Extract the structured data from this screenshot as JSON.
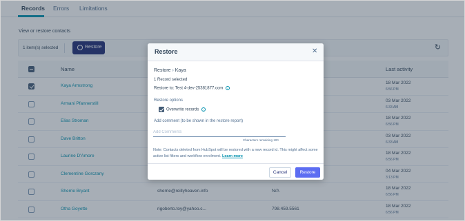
{
  "tabs": [
    {
      "label": "Records",
      "active": true
    },
    {
      "label": "Errors",
      "active": false
    },
    {
      "label": "Limitations",
      "active": false
    }
  ],
  "section_label": "View or restore contacts",
  "action_bar": {
    "selected_text": "1 item(s) selected",
    "restore_label": "Restore",
    "refresh_icon": "refresh-icon"
  },
  "table": {
    "headers": {
      "name": "Name",
      "last_activity": "Last activity"
    },
    "rows": [
      {
        "name": "Kaya Armstrong",
        "email": "",
        "phone": "",
        "date": "18 Mar 2022",
        "time": "6:56 PM",
        "checked": true
      },
      {
        "name": "Armani Pfannerstill",
        "email": "",
        "phone": "",
        "date": "03 Mar 2022",
        "time": "6:33 AM",
        "checked": false
      },
      {
        "name": "Elias Stroman",
        "email": "",
        "phone": "",
        "date": "18 Mar 2022",
        "time": "6:56 PM",
        "checked": false
      },
      {
        "name": "Dave Britton",
        "email": "",
        "phone": "",
        "date": "03 Mar 2022",
        "time": "6:33 AM",
        "checked": false
      },
      {
        "name": "Laurine D'Amore",
        "email": "",
        "phone": "",
        "date": "18 Mar 2022",
        "time": "6:56 PM",
        "checked": false
      },
      {
        "name": "Clementine Gorczany",
        "email": "",
        "phone": "",
        "date": "04 Mar 2022",
        "time": "3:13 PM",
        "checked": false
      },
      {
        "name": "Sherrie Bryant",
        "email": "sherrie@reillyheaven.info",
        "phone": "N/A",
        "date": "18 Mar 2022",
        "time": "6:56 PM",
        "checked": false
      },
      {
        "name": "Otha Goyette",
        "email": "rigoberto.toy@yahoo.c...",
        "phone": "798.459.5561",
        "date": "18 Mar 2022",
        "time": "6:56 PM",
        "checked": false
      }
    ]
  },
  "modal": {
    "title": "Restore",
    "crumb_prefix": "Restore",
    "crumb_arrow": "›",
    "crumb_name": "Kaya",
    "record_count": "1 Record selected",
    "restore_to": "Restore to: Test 4-dev-25381877.com",
    "restore_options_label": "Restore options",
    "overwrite_label": "Overwrite records",
    "overwrite_checked": true,
    "comment_label": "Add comment (to be shown in the restore report)",
    "comment_placeholder": "Add Comments",
    "comment_value": "",
    "chars_remaining": "Characters remaining 100",
    "note_text": "Note: Contacts deleted from HubSpot will be restored with a new record id. This might affect some active list filters and workflow enrolment.",
    "learn_more": "Learn more",
    "cancel_label": "Cancel",
    "confirm_label": "Restore"
  },
  "colors": {
    "accent": "#0091ae",
    "primary_button": "#5c6df2",
    "dark_button": "#1f2c75",
    "overlay": "#2d3e50"
  }
}
